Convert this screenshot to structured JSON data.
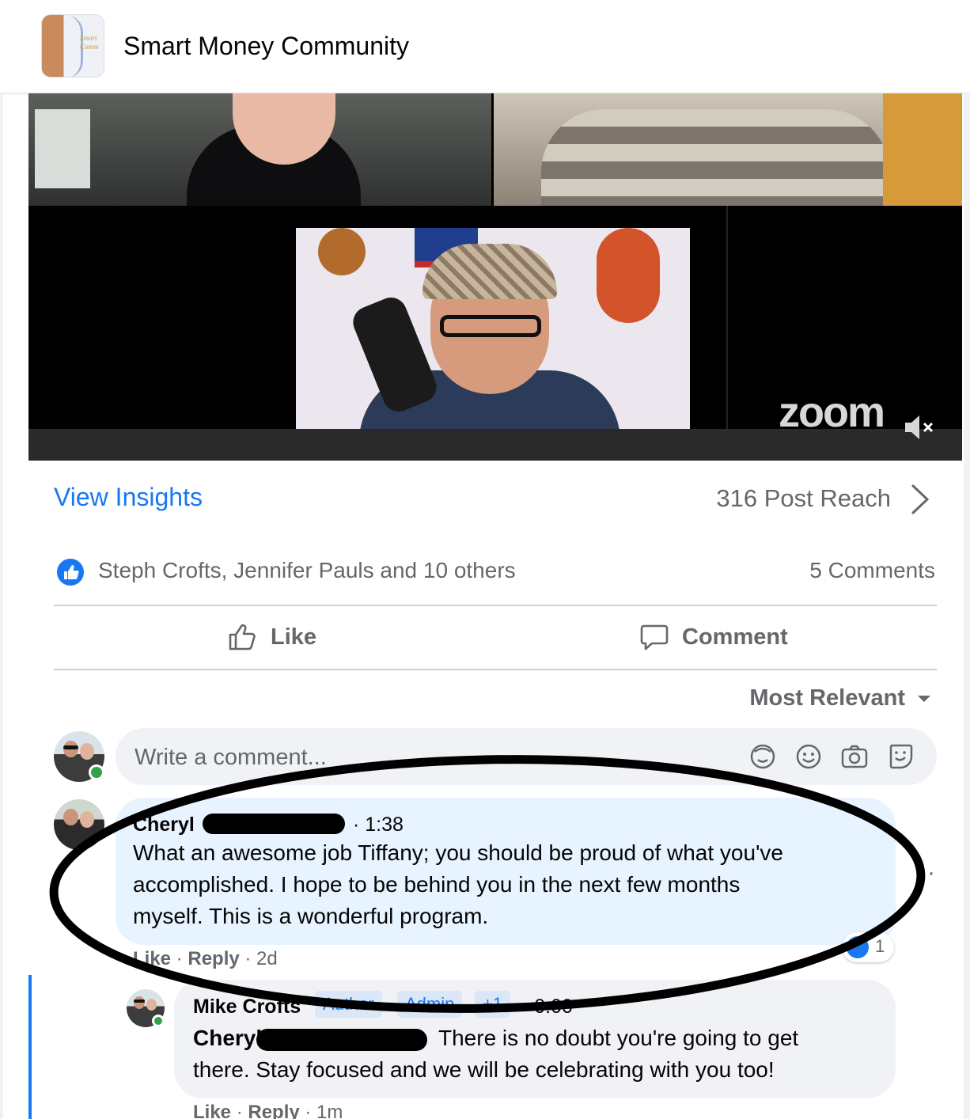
{
  "group": {
    "title": "Smart Money Community",
    "thumb_text": "Smart\nComm"
  },
  "video": {
    "logo": "zoom"
  },
  "insights": {
    "link_label": "View Insights",
    "reach": "316 Post Reach"
  },
  "reactions": {
    "names": "Steph Crofts, Jennifer Pauls and 10 others",
    "comments": "5 Comments"
  },
  "actions": {
    "like": "Like",
    "comment": "Comment"
  },
  "sort": {
    "label": "Most Relevant"
  },
  "composer": {
    "placeholder": "Write a comment..."
  },
  "comments": [
    {
      "author": "Cheryl",
      "time": "· 1:38",
      "text_lines": [
        "What an awesome job Tiffany; you should be proud of what you've",
        "accomplished. I hope to be behind you in the next few months",
        "myself. This is a wonderful program."
      ],
      "like": "Like",
      "reply": "Reply",
      "age": "· 2d",
      "reaction_count": "1"
    },
    {
      "author": "Mike Crofts",
      "badges": [
        "Author",
        "Admin",
        "+1"
      ],
      "time": "· 0:00",
      "mention": "Cheryl",
      "text_lines": [
        "There is no doubt you're going to get",
        "there. Stay focused and we will be celebrating with you too!"
      ],
      "like": "Like",
      "reply": "Reply",
      "age": "· 1m"
    }
  ],
  "colors": {
    "accent": "#1877f2",
    "secondary_text": "#65676b",
    "bubble_highlight": "#e7f3ff",
    "bubble": "#f0f2f5",
    "online": "#31a24c"
  }
}
